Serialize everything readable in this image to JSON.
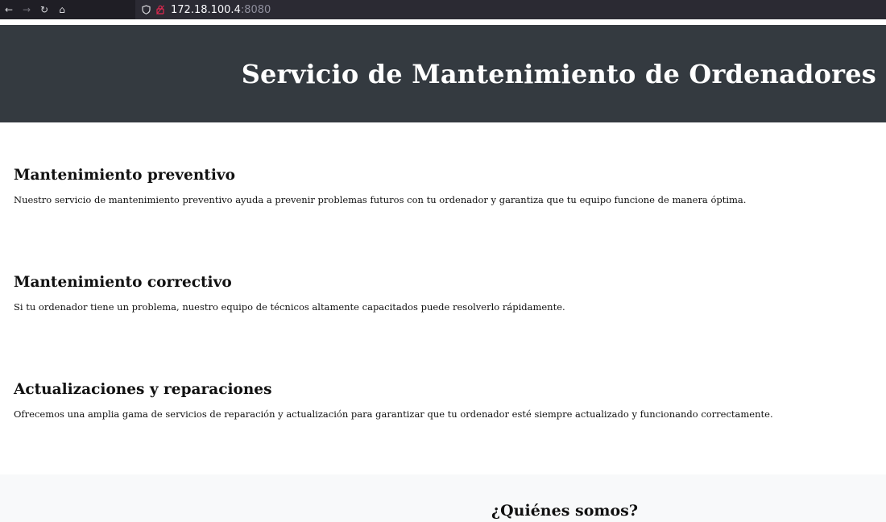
{
  "browser": {
    "back_icon": "arrow-left-icon",
    "forward_icon": "arrow-right-icon",
    "reload_icon": "reload-icon",
    "home_icon": "home-icon",
    "url_host": "172.18.100.4",
    "url_port": ":8080"
  },
  "header": {
    "title": "Servicio de Mantenimiento de Ordenadores"
  },
  "sections": [
    {
      "heading": "Mantenimiento preventivo",
      "text": "Nuestro servicio de mantenimiento preventivo ayuda a prevenir problemas futuros con tu ordenador y garantiza que tu equipo funcione de manera óptima."
    },
    {
      "heading": "Mantenimiento correctivo",
      "text": "Si tu ordenador tiene un problema, nuestro equipo de técnicos altamente capacitados puede resolverlo rápidamente."
    },
    {
      "heading": "Actualizaciones y reparaciones",
      "text": "Ofrecemos una amplia gama de servicios de reparación y actualización para garantizar que tu ordenador esté siempre actualizado y funcionando correctamente."
    }
  ],
  "about": {
    "heading": "¿Quiénes somos?"
  },
  "colors": {
    "header_bg": "#343a40",
    "about_bg": "#f8f9fa",
    "browser_bg": "#1f1e25",
    "urlbar_bg": "#2b2a33"
  }
}
